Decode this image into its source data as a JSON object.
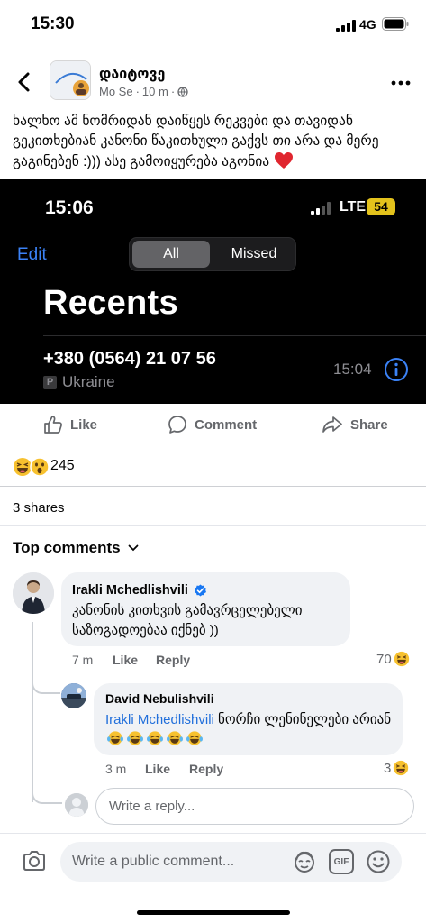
{
  "status_bar": {
    "time": "15:30",
    "network": "4G"
  },
  "post": {
    "page_name": "დაიტოვე",
    "author_label": "Mo Se",
    "age": "10 m",
    "text": "ხალხო ამ ნომრიდან დაიწყეს რეკვები და თავიდან გეკითხებიან კანონი წაკითხული გაქვს თი არა და მერე გაგინებენ :)))  ასე გამოიყურება აგონია"
  },
  "screenshot": {
    "time": "15:06",
    "network": "LTE",
    "battery": "54",
    "edit_label": "Edit",
    "tab_all": "All",
    "tab_missed": "Missed",
    "title": "Recents",
    "phone_number": "+380 (0564) 21 07 56",
    "country": "Ukraine",
    "country_badge": "P",
    "call_time": "15:04"
  },
  "actions": {
    "like": "Like",
    "comment": "Comment",
    "share": "Share"
  },
  "reactions": {
    "count": "245"
  },
  "shares_label": "3 shares",
  "top_comments_label": "Top comments",
  "comments": [
    {
      "author": "Irakli Mchedlishvili",
      "text": "კანონის კითხვის გამავრცელებელი საზოგადოებაა იქნებ ))",
      "time": "7 m",
      "like_label": "Like",
      "reply_label": "Reply",
      "reaction_count": "70"
    },
    {
      "author": "David  Nebulishvili",
      "mention": "Irakli Mchedlishvili",
      "text": " ნორჩი ლენინელები არიან ",
      "time": "3 m",
      "like_label": "Like",
      "reply_label": "Reply",
      "reaction_count": "3"
    }
  ],
  "reply_box": {
    "placeholder": "Write a reply..."
  },
  "bottom_bar": {
    "placeholder": "Write a public comment...",
    "gif_label": "GIF"
  },
  "colors": {
    "accent": "#216fdb",
    "ios_blue": "#3b82f6",
    "battery_yellow": "#e3c21c",
    "muted": "#65676b"
  }
}
